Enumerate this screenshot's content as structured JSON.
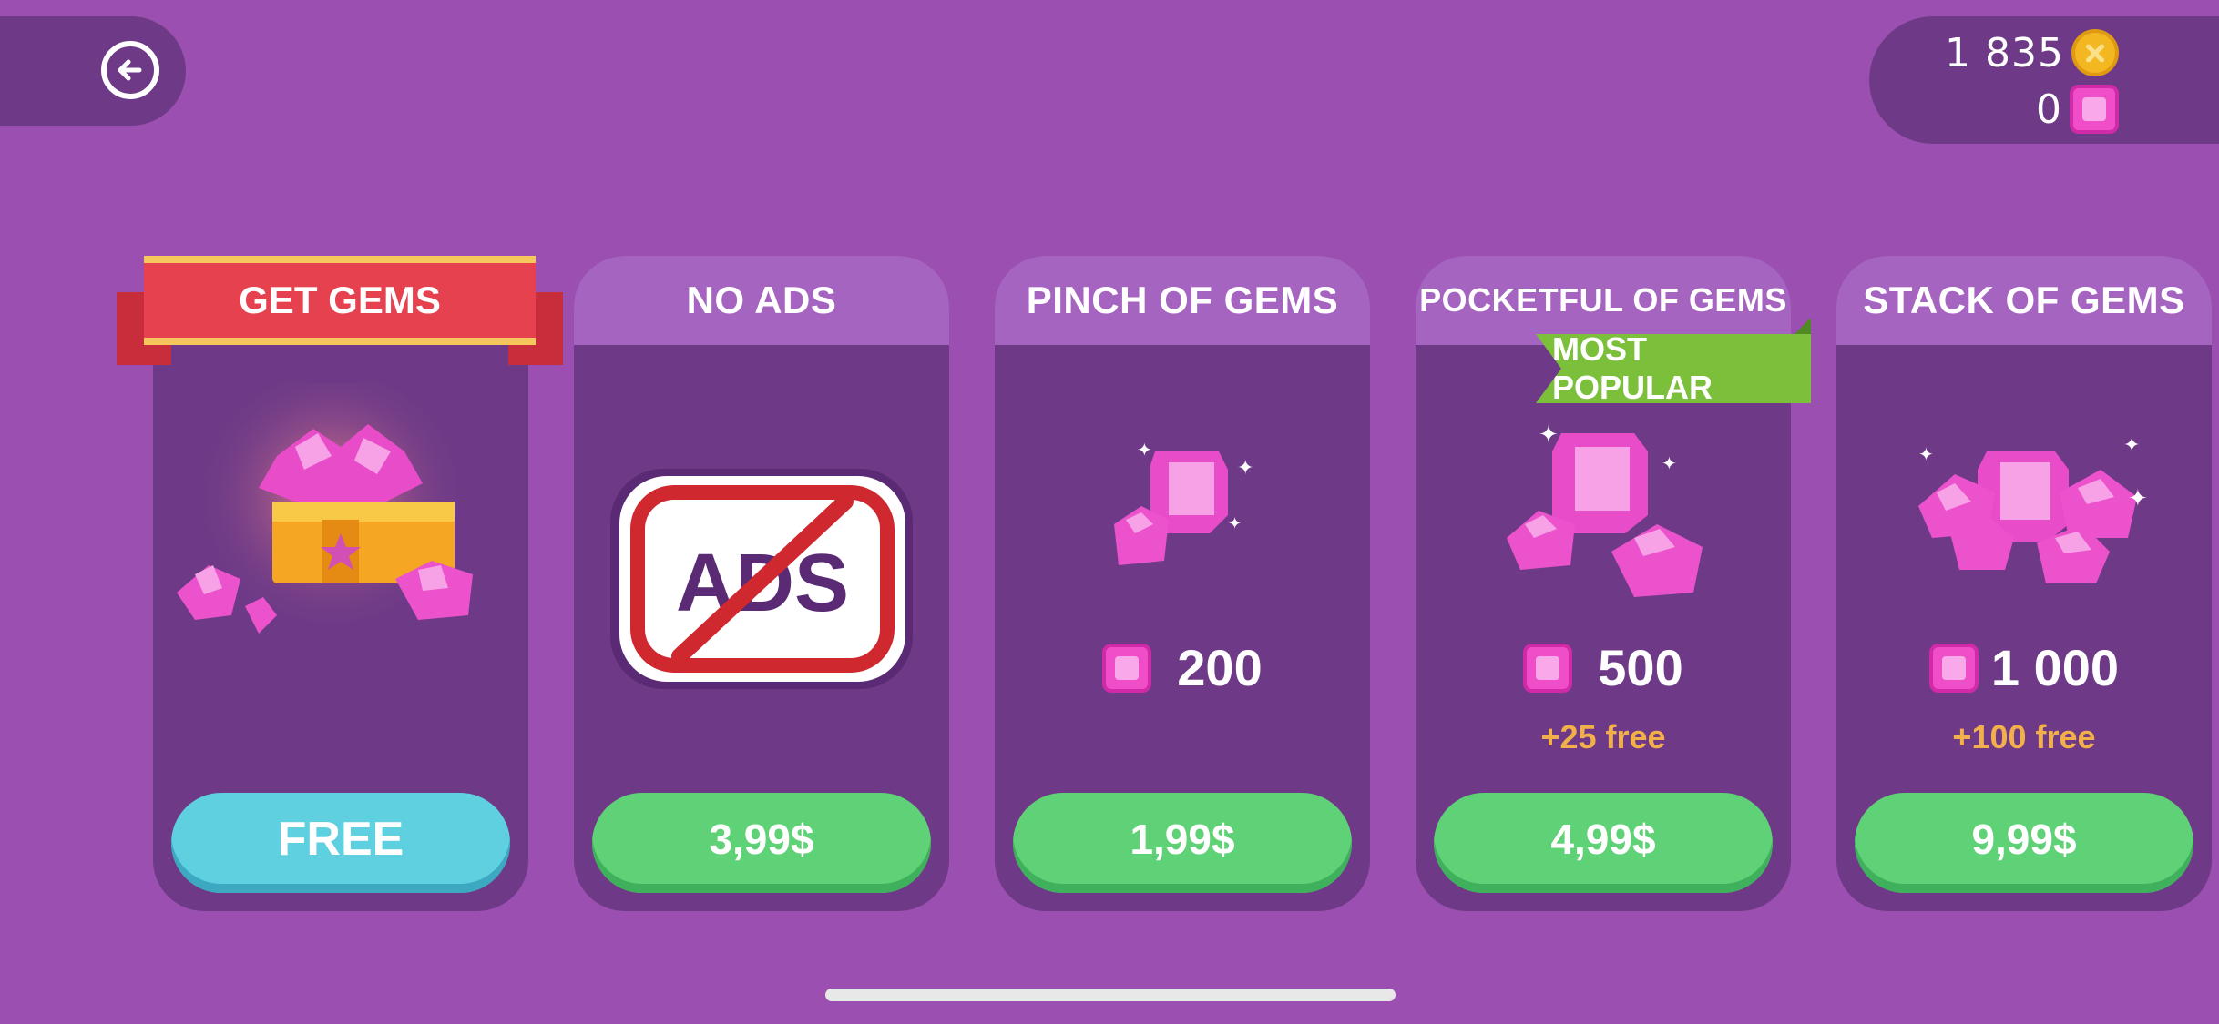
{
  "topbar": {
    "back_icon": "back-arrow-icon",
    "coins": "1 835",
    "coin_icon": "coin-icon",
    "gems": "0",
    "gem_icon": "gem-icon"
  },
  "cards": [
    {
      "title": "GET GEMS",
      "button": "FREE"
    },
    {
      "title": "NO ADS",
      "ads_text": "ADS",
      "button": "3,99$"
    },
    {
      "title": "PINCH OF GEMS",
      "qty": "200",
      "button": "1,99$"
    },
    {
      "title": "POCKETFUL OF GEMS",
      "qty": "500",
      "bonus": "+25 free",
      "button": "4,99$",
      "tag": "MOST POPULAR"
    },
    {
      "title": "STACK OF GEMS",
      "qty": "1 000",
      "bonus": "+100 free",
      "button": "9,99$"
    }
  ],
  "colors": {
    "background": "#9b4fb0",
    "card": "#6e3a87",
    "card_header": "#a564c0",
    "price_button": "#5fd176",
    "free_button": "#5ed0e0",
    "ribbon": "#e6414f",
    "popular_tag": "#7bbf3b",
    "bonus_text": "#f2b04a",
    "gem": "#f04dc8"
  }
}
